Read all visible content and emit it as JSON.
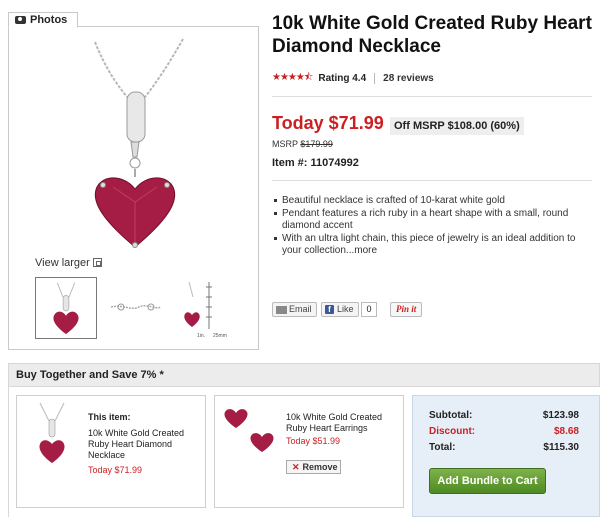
{
  "photos": {
    "tab_label": "Photos",
    "view_larger": "View larger",
    "thumb_dims": {
      "w": "1in.",
      "h": "25mm"
    }
  },
  "product": {
    "title": "10k White Gold Created Ruby Heart Diamond Necklace",
    "stars": "★★★★⯪",
    "rating_label": "Rating 4.4",
    "reviews": "28 reviews",
    "price": "Today $71.99",
    "off_msrp": "Off MSRP $108.00 (60%)",
    "msrp_label": "MSRP",
    "msrp_value": "$179.99",
    "item_number": "Item #: 11074992",
    "bullets": [
      "Beautiful necklace is crafted of 10-karat white gold",
      "Pendant features a rich ruby in a heart shape with a small, round diamond accent",
      "With an ultra light chain, this piece of jewelry is an ideal addition to your collection..."
    ],
    "more_link": "more"
  },
  "share": {
    "email": "Email",
    "like": "Like",
    "like_count": "0",
    "pinit": "Pin it"
  },
  "bundle": {
    "header": "Buy Together and Save 7% *",
    "this_item_label": "This item:",
    "item1_name": "10k White Gold Created Ruby Heart Diamond Necklace",
    "item1_price": "Today $71.99",
    "item2_name": "10k White Gold Created Ruby Heart Earrings",
    "item2_price": "Today $51.99",
    "remove": "Remove",
    "subtotal_label": "Subtotal:",
    "subtotal": "$123.98",
    "discount_label": "Discount:",
    "discount": "$8.68",
    "total_label": "Total:",
    "total": "$115.30",
    "add_button": "Add Bundle to Cart"
  },
  "colors": {
    "accent_red": "#cc1f22",
    "button_green": "#5a9a2b",
    "summary_bg": "#e6eef7"
  }
}
